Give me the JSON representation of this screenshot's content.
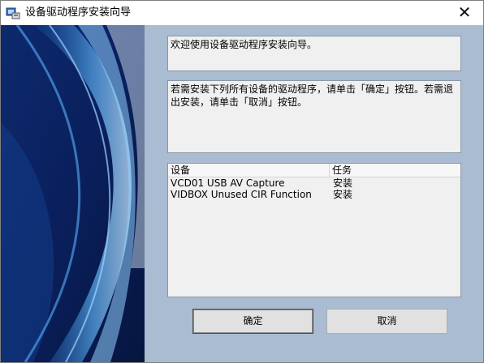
{
  "window": {
    "title": "设备驱动程序安装向导",
    "close_glyph": "✕",
    "icon": "installer-icon"
  },
  "welcome_text": "欢迎使用设备驱动程序安装向导。",
  "instruction_text": "若需安装下列所有设备的驱动程序，请单击「确定」按钮。若需退出安装，请单击「取消」按钮。",
  "device_list": {
    "columns": [
      "设备",
      "任务"
    ],
    "rows": [
      {
        "device": "VCD01 USB AV Capture",
        "task": "安装"
      },
      {
        "device": "VIDBOX Unused CIR Function",
        "task": "安装"
      }
    ]
  },
  "buttons": {
    "ok_label": "确定",
    "cancel_label": "取消"
  },
  "colors": {
    "background": "#a9bcd1",
    "banner_dark": "#0a1f5c",
    "banner_light": "#6fb8f0"
  }
}
